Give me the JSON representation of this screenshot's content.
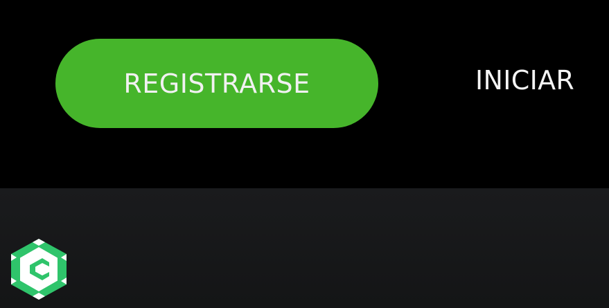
{
  "header": {
    "register_label": "REGISTRARSE",
    "login_label": "INICIAR"
  },
  "colors": {
    "background": "#000000",
    "accent_green": "#46b52b",
    "button_text": "#f1f1f1",
    "panel": "#1a1b1d",
    "logo_green": "#2fc46b"
  },
  "icons": {
    "logo": "hexagon-c-logo-icon"
  }
}
